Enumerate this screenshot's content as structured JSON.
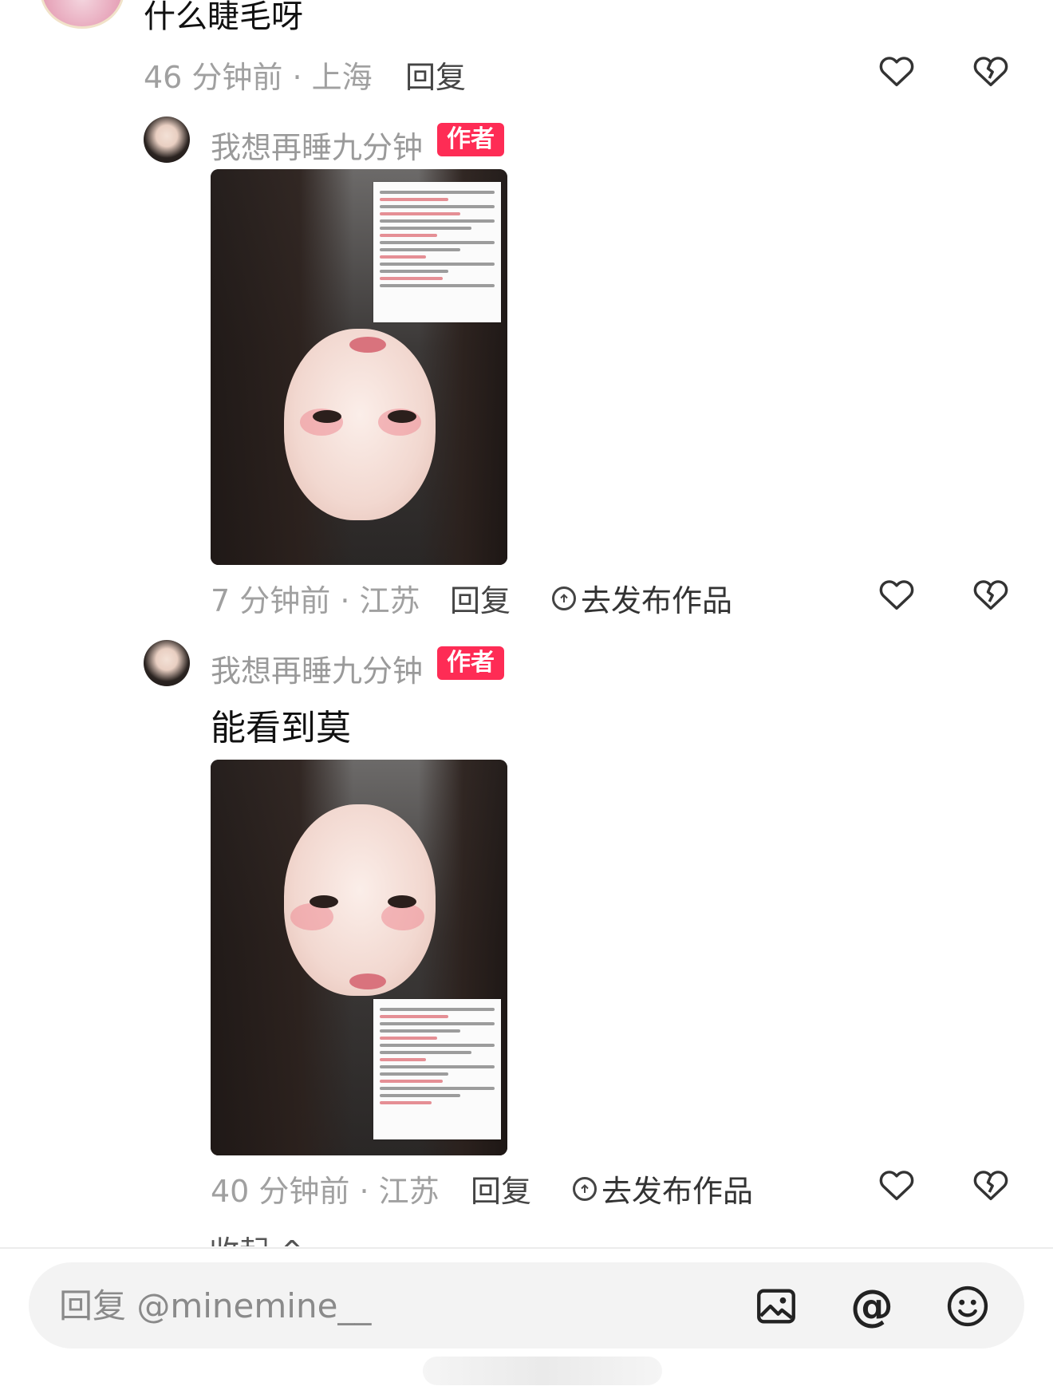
{
  "top_comment": {
    "text": "什么睫毛呀",
    "meta": "46 分钟前 · 上海",
    "reply_label": "回复"
  },
  "replies": [
    {
      "username": "我想再睡九分钟",
      "badge": "作者",
      "text": "",
      "meta": "7 分钟前 · 江苏",
      "reply_label": "回复",
      "publish_label": "去发布作品"
    },
    {
      "username": "我想再睡九分钟",
      "badge": "作者",
      "text": "能看到莫",
      "meta": "40 分钟前 · 江苏",
      "reply_label": "回复",
      "publish_label": "去发布作品"
    }
  ],
  "collapse_label": "收起 ^",
  "input": {
    "placeholder": "回复 @minemine__"
  },
  "icons": {
    "like": "heart-outline-icon",
    "dislike": "broken-heart-icon",
    "image": "image-icon",
    "mention": "at-icon",
    "emoji": "emoji-icon",
    "publish": "upload-circle-icon"
  },
  "colors": {
    "badge": "#fe2c55",
    "meta": "#a0a0a0",
    "input_bg": "#f3f3f3"
  }
}
